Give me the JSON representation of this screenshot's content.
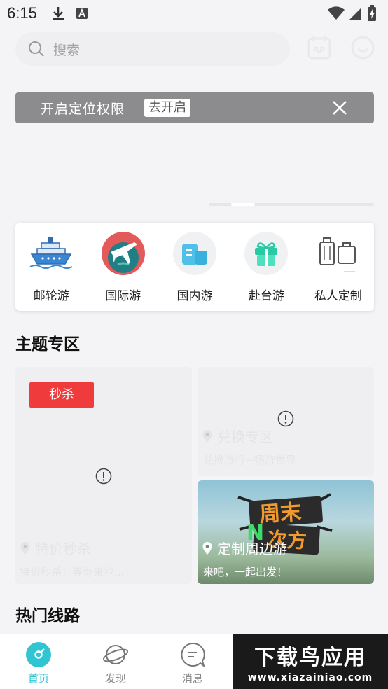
{
  "status_bar": {
    "time": "6:15"
  },
  "search": {
    "placeholder": "搜索"
  },
  "location_banner": {
    "text": "开启定位权限",
    "button": "去开启"
  },
  "categories": [
    {
      "label": "邮轮游",
      "icon": "cruise-ship-icon"
    },
    {
      "label": "国际游",
      "icon": "globe-plane-icon"
    },
    {
      "label": "国内游",
      "icon": "buildings-icon"
    },
    {
      "label": "赴台游",
      "icon": "gift-box-icon"
    },
    {
      "label": "私人定制",
      "icon": "luggage-icon"
    }
  ],
  "theme_section": {
    "title": "主题专区",
    "flash_sale": {
      "badge": "秒杀",
      "title": "特价秒杀",
      "subtitle": "特价秒杀！等你来抢..."
    },
    "exchange": {
      "title": "兑换专区",
      "subtitle": "兑换旅行~畅游世界"
    },
    "nearby": {
      "title": "定制周边游",
      "subtitle": "来吧，一起出发！",
      "poster_text_top": "周末",
      "poster_text_n": "N",
      "poster_text_bottom": "次方"
    }
  },
  "hot_routes": {
    "title": "热门线路"
  },
  "bottom_nav": [
    {
      "label": "首页",
      "active": true
    },
    {
      "label": "发现",
      "active": false
    },
    {
      "label": "消息",
      "active": false
    }
  ],
  "watermark": {
    "line1": "下载鸟应用",
    "line2": "www.xiazainiao.com"
  },
  "colors": {
    "accent": "#2fc6d2",
    "flash_red": "#ef3b3b",
    "banner_gray": "#8c8c8e"
  }
}
